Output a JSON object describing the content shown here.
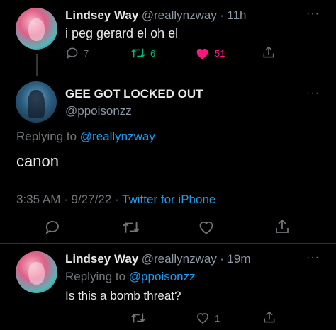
{
  "tweet1": {
    "name": "Lindsey Way",
    "handle": "@reallynzway",
    "dot": "·",
    "time": "11h",
    "text": "i peg gerard el oh el",
    "replies": "7",
    "retweets": "6",
    "likes": "51"
  },
  "main": {
    "name": "GEE GOT LOCKED OUT",
    "handle": "@ppoisonzz",
    "replying_label": "Replying to",
    "replying_handle": "@reallynzway",
    "text": "canon",
    "time": "3:35 AM",
    "date": "9/27/22",
    "sep": "·",
    "source": "Twitter for iPhone"
  },
  "reply": {
    "name": "Lindsey Way",
    "handle": "@reallynzway",
    "dot": "·",
    "time": "19m",
    "replying_label": "Replying to",
    "replying_handle": "@ppoisonzz",
    "text": "Is this a bomb threat?",
    "likes": "1"
  },
  "icons": {
    "reply": "reply-icon",
    "retweet": "retweet-icon",
    "like": "heart-icon",
    "share": "share-icon",
    "more": "more-icon"
  },
  "colors": {
    "background": "#000000",
    "text": "#e7e9ea",
    "muted": "#71767b",
    "link": "#1d9bf0",
    "retweet": "#00ba7c",
    "like": "#f91880",
    "divider": "#2f3336"
  }
}
